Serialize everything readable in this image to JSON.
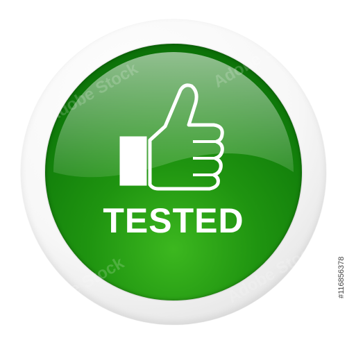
{
  "badge": {
    "label": "TESTED",
    "icon": "thumbs-up-icon",
    "colors": {
      "disc_dark": "#086506",
      "disc_light": "#3cb71f",
      "ring": "#f2f2f2",
      "text": "#ffffff"
    }
  },
  "stock": {
    "image_id": "#116856378",
    "watermark": "Adobe Stock"
  }
}
